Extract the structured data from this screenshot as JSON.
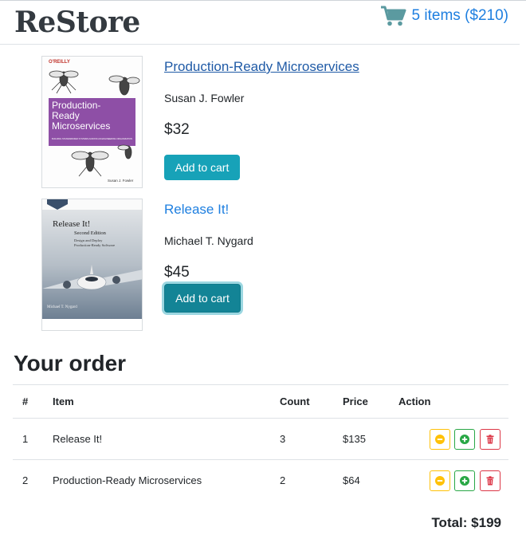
{
  "app": {
    "brand": "ReStore"
  },
  "cart": {
    "summary": "5 items ($210)",
    "icon": "shopping-cart-icon",
    "color": "#1e7fe0"
  },
  "books": [
    {
      "title": "Production-Ready Microservices",
      "author": "Susan J. Fowler",
      "price": "$32",
      "button_label": "Add to cart",
      "cover": {
        "publisher": "O'REILLY",
        "lines": [
          "Production-",
          "Ready",
          "Microservices"
        ],
        "subtitle": "BUILDING STANDARDIZED SYSTEMS ACROSS AN ENGINEERING ORGANIZATION",
        "author": "Susan J. Fowler"
      }
    },
    {
      "title": "Release It!",
      "author": "Michael T. Nygard",
      "price": "$45",
      "button_label": "Add to cart",
      "cover": {
        "title": "Release It!",
        "edition": "Second Edition",
        "tagline1": "Design and Deploy",
        "tagline2": "Production-Ready Software",
        "author": "Michael T. Nygard"
      }
    }
  ],
  "order": {
    "heading": "Your order",
    "columns": [
      "#",
      "Item",
      "Count",
      "Price",
      "Action"
    ],
    "rows": [
      {
        "num": "1",
        "item": "Release It!",
        "count": "3",
        "price": "$135"
      },
      {
        "num": "2",
        "item": "Production-Ready Microservices",
        "count": "2",
        "price": "$64"
      }
    ],
    "total": "Total: $199"
  },
  "colors": {
    "accent": "#17a2b8",
    "warning": "#ffc107",
    "success": "#28a745",
    "danger": "#dc3545"
  }
}
